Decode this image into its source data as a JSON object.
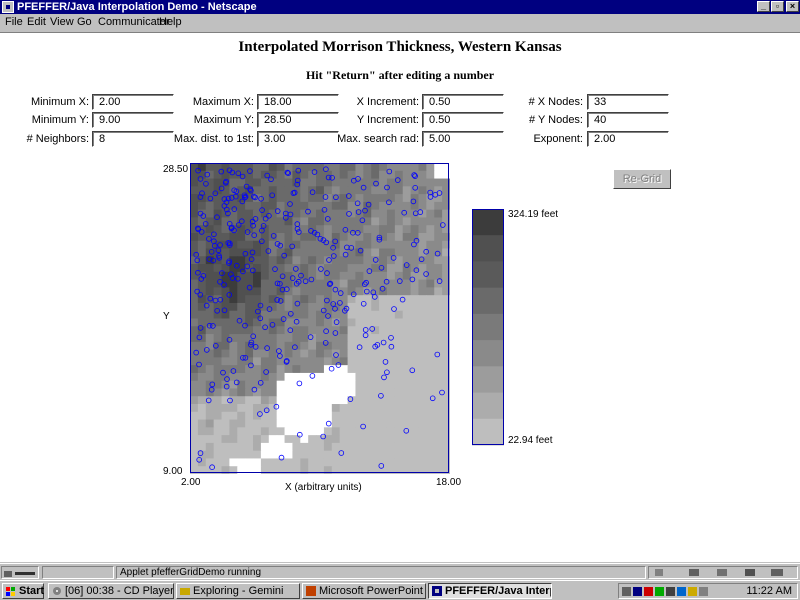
{
  "window": {
    "title": "PFEFFER/Java Interpolation Demo - Netscape"
  },
  "menu": [
    "File",
    "Edit",
    "View",
    "Go",
    "Communicator",
    "Help"
  ],
  "page": {
    "title": "Interpolated Morrison Thickness, Western Kansas",
    "subtitle": "Hit \"Return\" after editing a number"
  },
  "fields": [
    {
      "label": "Minimum X:",
      "value": "2.00"
    },
    {
      "label": "Maximum X:",
      "value": "18.00"
    },
    {
      "label": "X Increment:",
      "value": "0.50"
    },
    {
      "label": "# X Nodes:",
      "value": "33"
    },
    {
      "label": "Minimum Y:",
      "value": "9.00"
    },
    {
      "label": "Maximum Y:",
      "value": "28.50"
    },
    {
      "label": "Y Increment:",
      "value": "0.50"
    },
    {
      "label": "# Y Nodes:",
      "value": "40"
    },
    {
      "label": "# Neighbors:",
      "value": "8"
    },
    {
      "label": "Max. dist. to 1st:",
      "value": "3.00"
    },
    {
      "label": "Max. search rad:",
      "value": "5.00"
    },
    {
      "label": "Exponent:",
      "value": "2.00"
    }
  ],
  "regrid_label": "Re-Grid",
  "plot": {
    "x_axis_label": "X (arbitrary units)",
    "y_axis_label": "Y",
    "x_min_label": "2.00",
    "x_max_label": "18.00",
    "y_min_label": "9.00",
    "y_max_label": "28.50",
    "point_color": "#0000ff"
  },
  "legend": {
    "max_label": "324.19 feet",
    "min_label": "22.94 feet",
    "shades": [
      "#3c3c3c",
      "#505050",
      "#5a5a5a",
      "#6a6a6a",
      "#7a7a7a",
      "#8a8a8a",
      "#9c9c9c",
      "#acacac",
      "#bebebe"
    ]
  },
  "status": {
    "text": "Applet pfefferGridDemo running"
  },
  "taskbar": {
    "start_label": "Start",
    "tasks": [
      "[06] 00:38 - CD Player",
      "Exploring - Gemini",
      "Microsoft PowerPoint - [02...",
      "PFEFFER/Java Interp..."
    ],
    "clock": "11:22 AM"
  }
}
